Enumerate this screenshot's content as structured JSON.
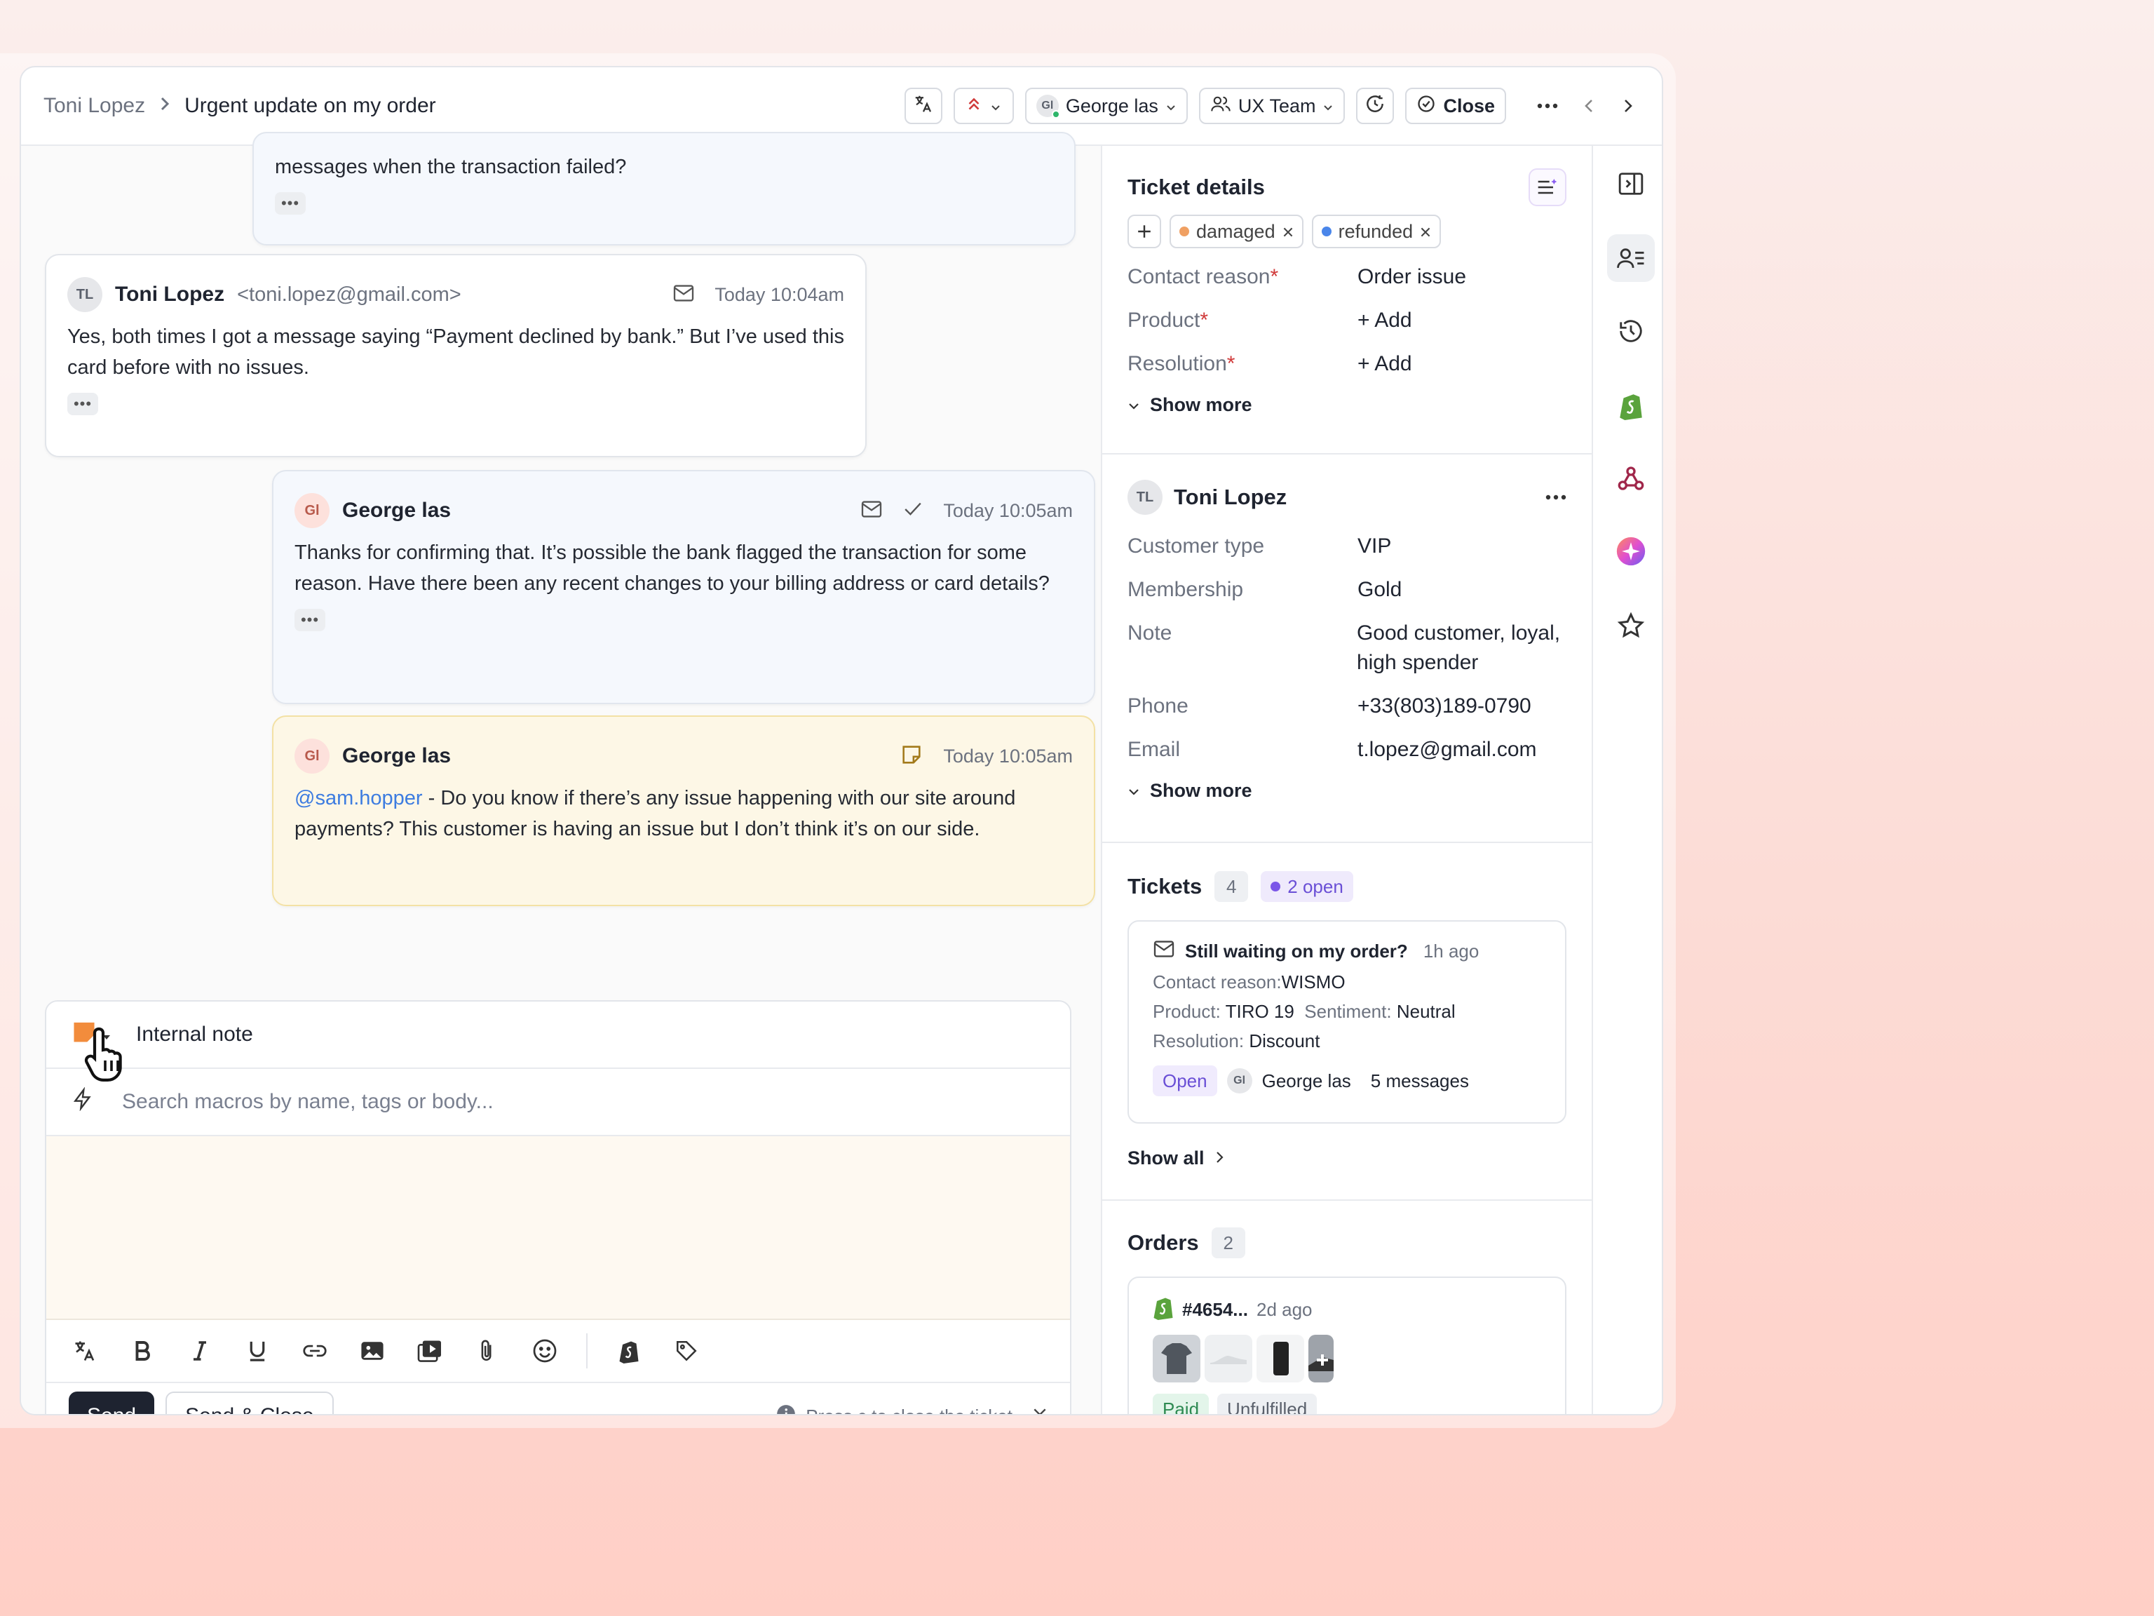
{
  "header": {
    "breadcrumb_customer": "Toni Lopez",
    "ticket_title": "Urgent update on my order",
    "assignee": "George las",
    "assignee_initials": "Gl",
    "team": "UX Team",
    "close_label": "Close"
  },
  "messages": [
    {
      "text": "messages when the transaction failed?"
    },
    {
      "initials": "TL",
      "name": "Toni Lopez",
      "email": "<toni.lopez@gmail.com>",
      "time": "Today 10:04am",
      "text": "Yes, both times I got a message saying “Payment declined by bank.” But I’ve used this card before with no issues."
    },
    {
      "initials": "Gl",
      "name": "George las",
      "time": "Today 10:05am",
      "text": "Thanks for confirming that. It’s possible the bank flagged the transaction for some reason. Have there been any recent changes to your billing address or card details?"
    },
    {
      "initials": "Gl",
      "name": "George las",
      "time": "Today 10:05am",
      "mention": "@sam.hopper",
      "text": " - Do you know if there’s any issue happening with our site around payments? This customer is having an issue but I don’t think it’s on our side."
    }
  ],
  "composer": {
    "mode": "Internal note",
    "macro_placeholder": "Search macros by name, tags or body...",
    "send_label": "Send",
    "send_close_label": "Send & Close",
    "hint": "Press c to close the ticket"
  },
  "ticket_details": {
    "title": "Ticket details",
    "tags": [
      {
        "label": "damaged",
        "color": "#f0a062"
      },
      {
        "label": "refunded",
        "color": "#4a86ea"
      }
    ],
    "fields": [
      {
        "key": "Contact reason",
        "value": "Order issue"
      },
      {
        "key": "Product",
        "value": "+ Add"
      },
      {
        "key": "Resolution",
        "value": "+ Add"
      }
    ],
    "show_more": "Show more"
  },
  "customer": {
    "initials": "TL",
    "name": "Toni Lopez",
    "fields": [
      {
        "key": "Customer type",
        "value": "VIP"
      },
      {
        "key": "Membership",
        "value": "Gold"
      },
      {
        "key": "Note",
        "value": "Good customer, loyal, high spender"
      },
      {
        "key": "Phone",
        "value": "+33(803)189-0790"
      },
      {
        "key": "Email",
        "value": "t.lopez@gmail.com"
      }
    ],
    "show_more": "Show more"
  },
  "tickets": {
    "title": "Tickets",
    "count": "4",
    "open_label": "2 open",
    "card": {
      "subject": "Still waiting on my order?",
      "age": "1h ago",
      "contact_reason_key": "Contact reason:",
      "contact_reason": "WISMO",
      "product_key": "Product:",
      "product": "TIRO 19",
      "sentiment_key": "Sentiment:",
      "sentiment": "Neutral",
      "resolution_key": "Resolution:",
      "resolution": "Discount",
      "status": "Open",
      "agent_initials": "Gl",
      "agent": "George las",
      "messages": "5 messages"
    },
    "show_all": "Show all"
  },
  "orders": {
    "title": "Orders",
    "count": "2",
    "order_id": "#4654...",
    "age": "2d ago",
    "status_paid": "Paid",
    "status_fulfill": "Unfulfilled"
  }
}
